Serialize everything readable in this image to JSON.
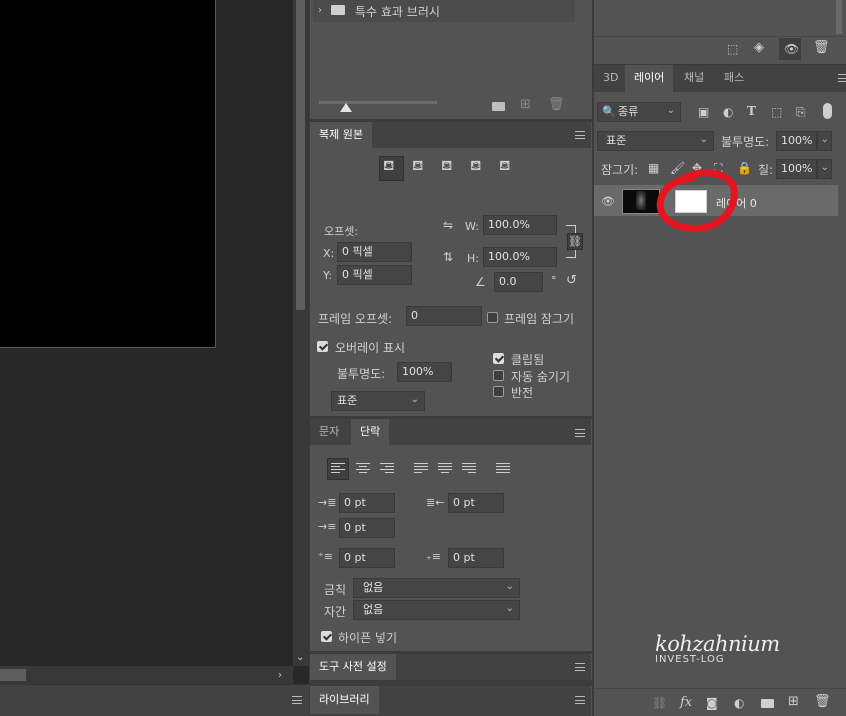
{
  "canvas_area": {},
  "brush_presets": {
    "item_label": "특수 효과 브러시"
  },
  "clone_source": {
    "tab_label": "복제 원본",
    "offset_label": "오프셋:",
    "x_label": "X:",
    "x_value": "0 픽셀",
    "y_label": "Y:",
    "y_value": "0 픽셀",
    "w_label": "W:",
    "w_value": "100.0%",
    "h_label": "H:",
    "h_value": "100.0%",
    "angle_value": "0.0",
    "degree_symbol": "°",
    "frame_offset_label": "프레임 오프셋:",
    "frame_offset_value": "0",
    "frame_lock_label": "프레임 잠그기",
    "show_overlay_label": "오버레이 표시",
    "opacity_label": "불투명도:",
    "opacity_value": "100%",
    "blend_value": "표준",
    "clipped_label": "클립됨",
    "auto_hide_label": "자동 숨기기",
    "invert_label": "반전"
  },
  "paragraph": {
    "tab_character": "문자",
    "tab_paragraph": "단락",
    "indent_left": "0 pt",
    "indent_right": "0 pt",
    "indent_first": "0 pt",
    "space_before": "0 pt",
    "space_after": "0 pt",
    "kinsoku_label": "금칙",
    "kinsoku_value": "없음",
    "mojikumi_label": "자간",
    "mojikumi_value": "없음",
    "hyphenate_label": "하이픈 넣기"
  },
  "tool_presets": {
    "tab_label": "도구 사전 설정"
  },
  "libraries": {
    "tab_label": "라이브러리"
  },
  "layers_panel": {
    "tabs": [
      "3D",
      "레이어",
      "채널",
      "패스"
    ],
    "filter_kind": "종류",
    "blend_mode": "표준",
    "opacity_label": "불투명도:",
    "opacity_value": "100%",
    "lock_label": "잠그기:",
    "fill_label": "칠:",
    "fill_value": "100%",
    "layer_name": "레이어 0",
    "fx_label": "fx"
  },
  "watermark": {
    "line1": "kohzahnium",
    "line2": "INVEST-LOG"
  },
  "colors": {
    "annotation_circle": "#e5151f",
    "panel_bg": "#535353",
    "canvas_black": "#000000"
  }
}
